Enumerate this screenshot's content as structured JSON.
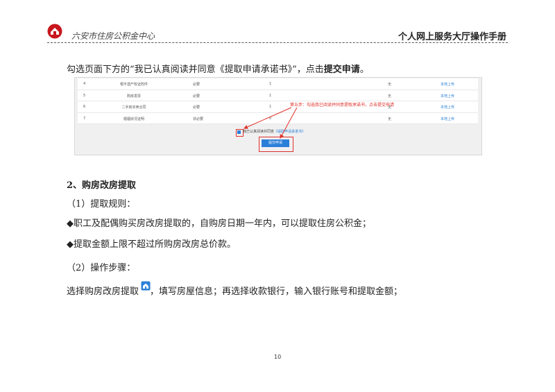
{
  "header": {
    "org_name": "六安市住房公积金中心",
    "manual_title": "个人网上服务大厅操作手册",
    "logo_icon": "center-logo-icon",
    "brand_color": "#c8161d"
  },
  "instruction": {
    "before": "勾选页面下方的“我已认真阅读并同意《提取申请承诺书》”，点击",
    "bold": "提交申请",
    "after": "。"
  },
  "screenshot": {
    "rows": [
      {
        "no": "4",
        "name": "根不送产权证附件",
        "req": "必要",
        "count": "1",
        "status": "无",
        "action": "本地上传"
      },
      {
        "no": "5",
        "name": "购房发票",
        "req": "必要",
        "count": "1",
        "status": "无",
        "action": "本地上传"
      },
      {
        "no": "6",
        "name": "二手房买卖合同",
        "req": "必要",
        "count": "1",
        "status": "无",
        "action": "本地上传"
      },
      {
        "no": "7",
        "name": "婚姻状况证明",
        "req": "非必要",
        "count": "0",
        "status": "无",
        "action": "本地上传"
      }
    ],
    "agree_text": "我已认真阅读并同意",
    "agree_link": "《提取申请承诺书》",
    "submit_label": "提交申请",
    "annotation": "第五步：勾选我已阅读并同意提取承诺书，点击提交申请",
    "accent_color": "#2a7fd8",
    "highlight_color": "#e0302a"
  },
  "section": {
    "title": "2、购房改房提取",
    "rule_heading": "（1）提取规则：",
    "bullet1": "◆职工及配偶购买房改房提取的，自购房日期一年内，可以提取住房公积金；",
    "bullet2": "◆提取金额上限不超过所购房改房总价款。",
    "steps_heading": "（2）操作步骤：",
    "step_before": "选择购房改房提取",
    "step_icon": "house-icon",
    "step_after": "，填写房屋信息；再选择收款银行，输入银行账号和提取金额；"
  },
  "page_number": "10"
}
